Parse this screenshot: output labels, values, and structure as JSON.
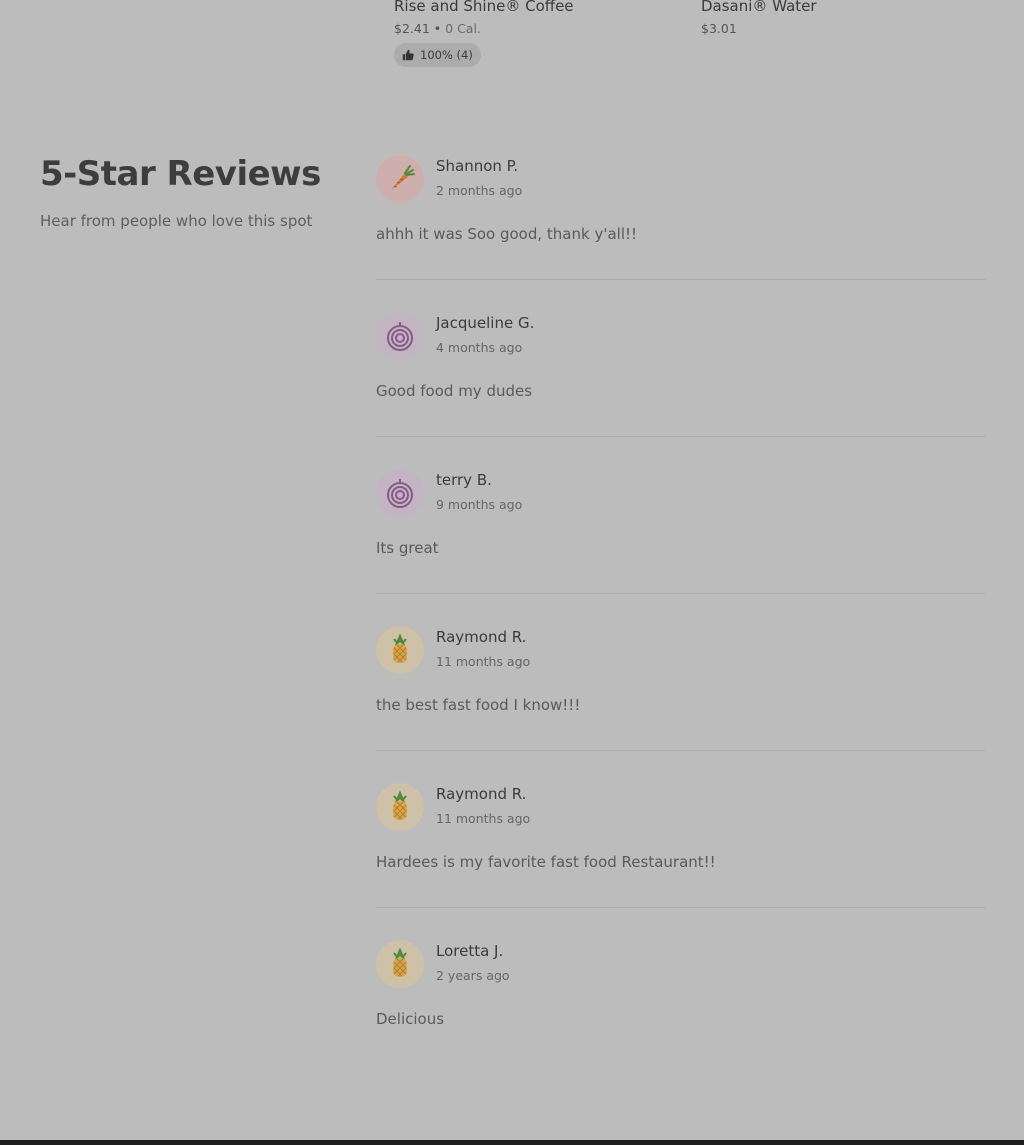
{
  "menu_items": [
    {
      "name": "Rise and Shine® Coffee",
      "price": "$2.41",
      "separator": "•",
      "calories": "0 Cal.",
      "rating": "100% (4)"
    },
    {
      "name": "Dasani® Water",
      "price": "$3.01"
    }
  ],
  "reviews_section": {
    "title": "5-Star Reviews",
    "subtitle": "Hear from people who love this spot",
    "reviews": [
      {
        "name": "Shannon P.",
        "time": "2 months ago",
        "text": "ahhh it was Soo good, thank y'all!!",
        "avatar": "carrot-icon"
      },
      {
        "name": "Jacqueline G.",
        "time": "4 months ago",
        "text": "Good food my dudes",
        "avatar": "onion-icon"
      },
      {
        "name": "terry B.",
        "time": "9 months ago",
        "text": "Its great",
        "avatar": "onion-icon"
      },
      {
        "name": "Raymond R.",
        "time": "11 months ago",
        "text": "the best fast food I know!!!",
        "avatar": "pineapple-icon"
      },
      {
        "name": "Raymond R.",
        "time": "11 months ago",
        "text": "Hardees is my favorite fast food Restaurant!!",
        "avatar": "pineapple-icon"
      },
      {
        "name": "Loretta J.",
        "time": "2 years ago",
        "text": "Delicious",
        "avatar": "pineapple-icon"
      }
    ]
  },
  "colors": {
    "overlay_background": "#bcbcbc",
    "carrot_avatar_bg": "#cfaeae",
    "onion_avatar_bg": "#c2b4c2",
    "pineapple_avatar_bg": "#cdc1a8"
  }
}
